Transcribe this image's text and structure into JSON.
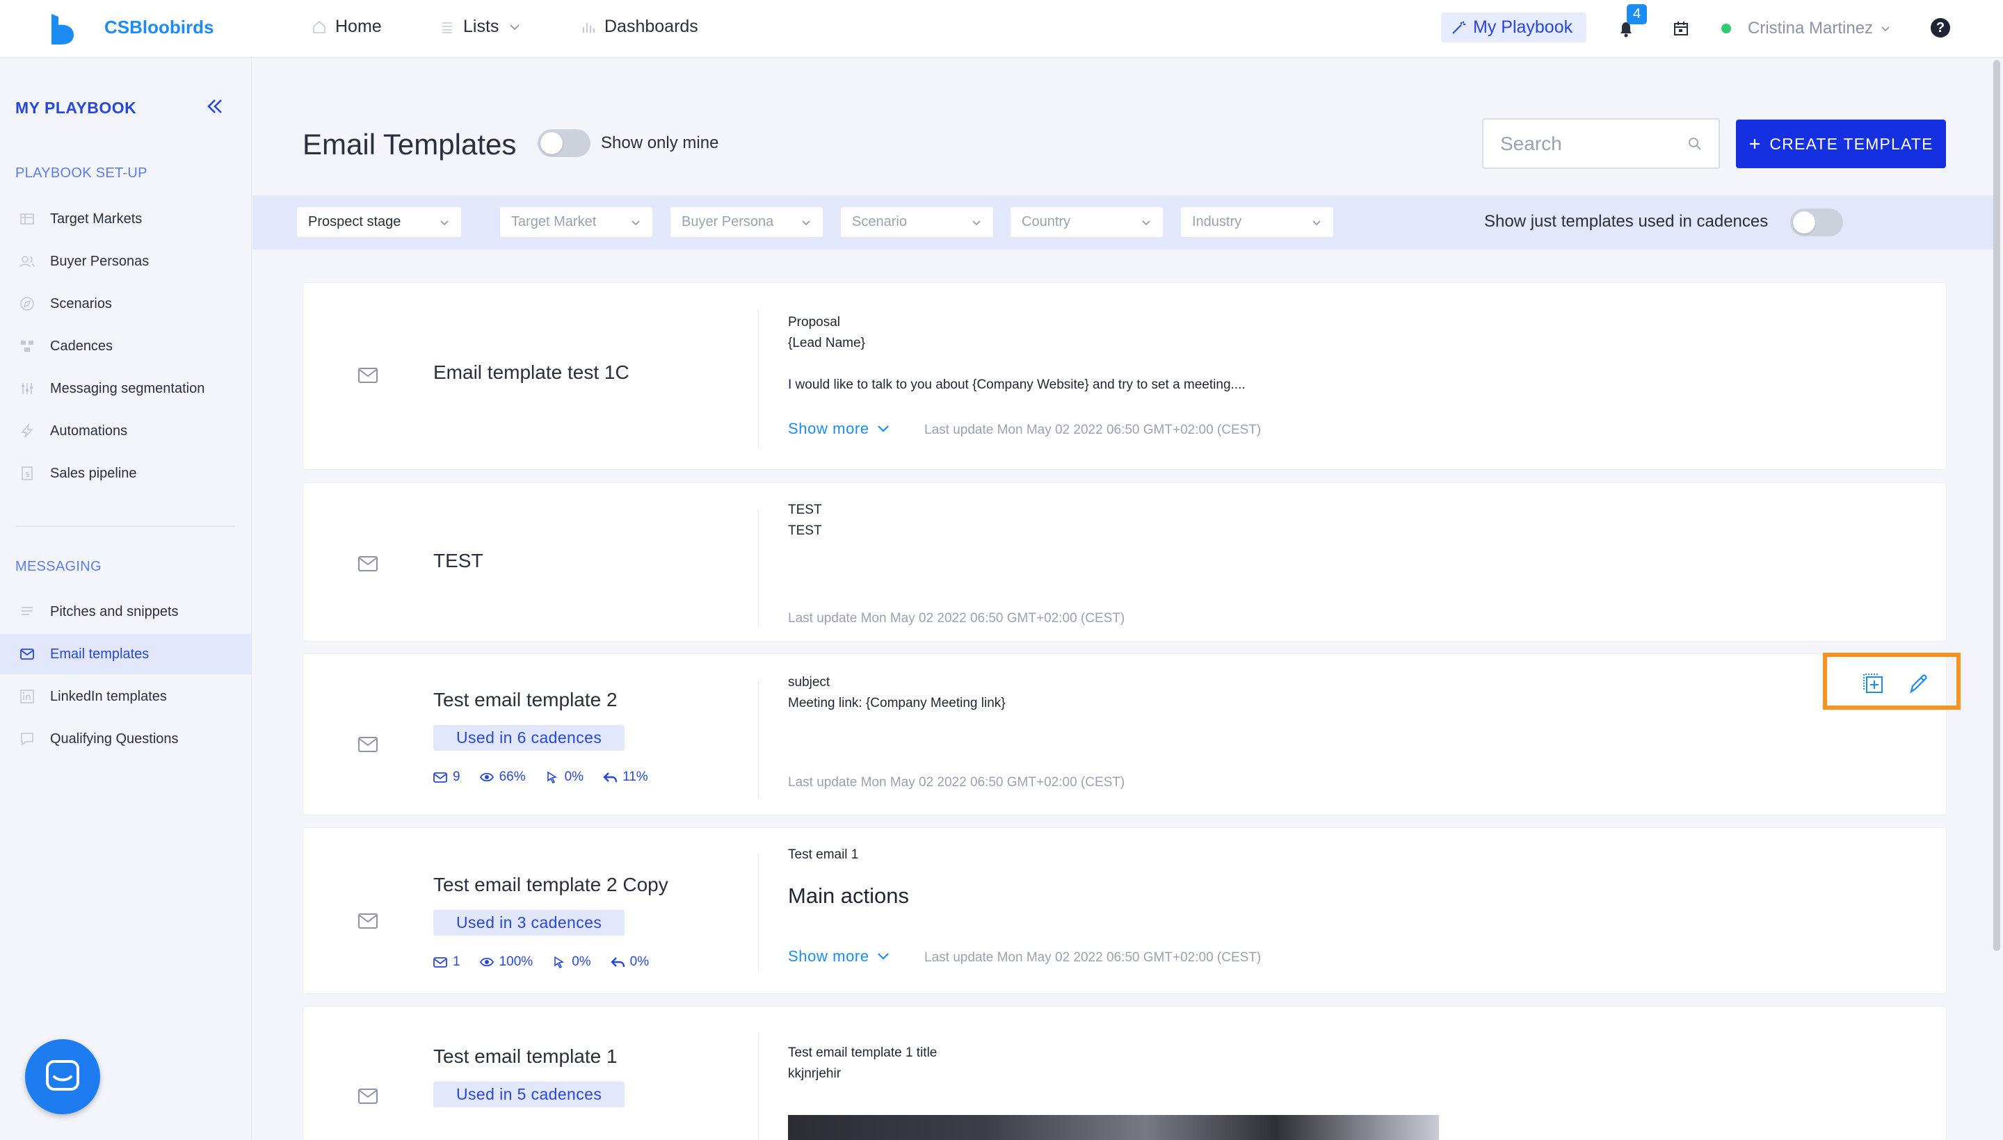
{
  "header": {
    "brand": "CSBloobirds",
    "nav": [
      {
        "label": "Home",
        "icon": "home-icon"
      },
      {
        "label": "Lists",
        "icon": "list-icon"
      },
      {
        "label": "Dashboards",
        "icon": "bar-chart-icon"
      }
    ],
    "playbook_label": "My Playbook",
    "notification_count": "4",
    "user_name": "Cristina Martinez",
    "help_label": "?"
  },
  "sidebar": {
    "title": "MY PLAYBOOK",
    "setup_section": "PLAYBOOK SET-UP",
    "setup_items": [
      {
        "label": "Target Markets",
        "icon": "target-markets-icon"
      },
      {
        "label": "Buyer Personas",
        "icon": "buyer-personas-icon"
      },
      {
        "label": "Scenarios",
        "icon": "scenarios-icon"
      },
      {
        "label": "Cadences",
        "icon": "cadences-icon"
      },
      {
        "label": "Messaging segmentation",
        "icon": "sliders-icon"
      },
      {
        "label": "Automations",
        "icon": "bolt-icon"
      },
      {
        "label": "Sales pipeline",
        "icon": "pipeline-icon"
      }
    ],
    "messaging_section": "MESSAGING",
    "messaging_items": [
      {
        "label": "Pitches and snippets",
        "icon": "lines-icon"
      },
      {
        "label": "Email templates",
        "icon": "mail-icon",
        "active": true
      },
      {
        "label": "LinkedIn templates",
        "icon": "linkedin-icon"
      },
      {
        "label": "Qualifying Questions",
        "icon": "chat-icon"
      }
    ]
  },
  "page": {
    "title": "Email Templates",
    "show_only_mine_label": "Show only mine",
    "show_only_mine": false,
    "search_placeholder": "Search",
    "create_button": "CREATE TEMPLATE"
  },
  "filters": {
    "items": [
      "Prospect stage",
      "Target Market",
      "Buyer Persona",
      "Scenario",
      "Country",
      "Industry"
    ],
    "cadence_toggle_label": "Show just templates used in cadences",
    "cadence_toggle": false
  },
  "templates": [
    {
      "name": "Email template test 1C",
      "subject": "Proposal",
      "body_lines": [
        "{Lead Name}",
        "",
        "I would like to talk to you about {Company Website} and try to set a meeting...."
      ],
      "show_more": "Show more",
      "last_update": "Last update Mon May 02 2022 06:50 GMT+02:00 (CEST)"
    },
    {
      "name": "TEST",
      "subject": "TEST",
      "body_lines": [
        "TEST"
      ],
      "last_update": "Last update Mon May 02 2022 06:50 GMT+02:00 (CEST)"
    },
    {
      "name": "Test email template 2",
      "pill": "Used in 6 cadences",
      "stats": {
        "sent": "9",
        "opened": "66%",
        "clicked": "0%",
        "replied": "11%"
      },
      "subject": "subject",
      "body_lines": [
        "Meeting link: {Company Meeting link}"
      ],
      "last_update": "Last update Mon May 02 2022 06:50 GMT+02:00 (CEST)"
    },
    {
      "name": "Test email template 2 Copy",
      "pill": "Used in 3 cadences",
      "stats": {
        "sent": "1",
        "opened": "100%",
        "clicked": "0%",
        "replied": "0%"
      },
      "subject": "Test email 1",
      "heading": "Main actions",
      "show_more": "Show more",
      "last_update": "Last update Mon May 02 2022 06:50 GMT+02:00 (CEST)"
    },
    {
      "name": "Test email template 1",
      "pill": "Used in 5 cadences",
      "subject": "Test email template 1 title",
      "body_lines": [
        "kkjnrjehir"
      ]
    }
  ],
  "colors": {
    "accent": "#1530e0",
    "link": "#1c8cf5",
    "highlight": "#f7931e",
    "pill_bg": "#e2e7fb"
  }
}
